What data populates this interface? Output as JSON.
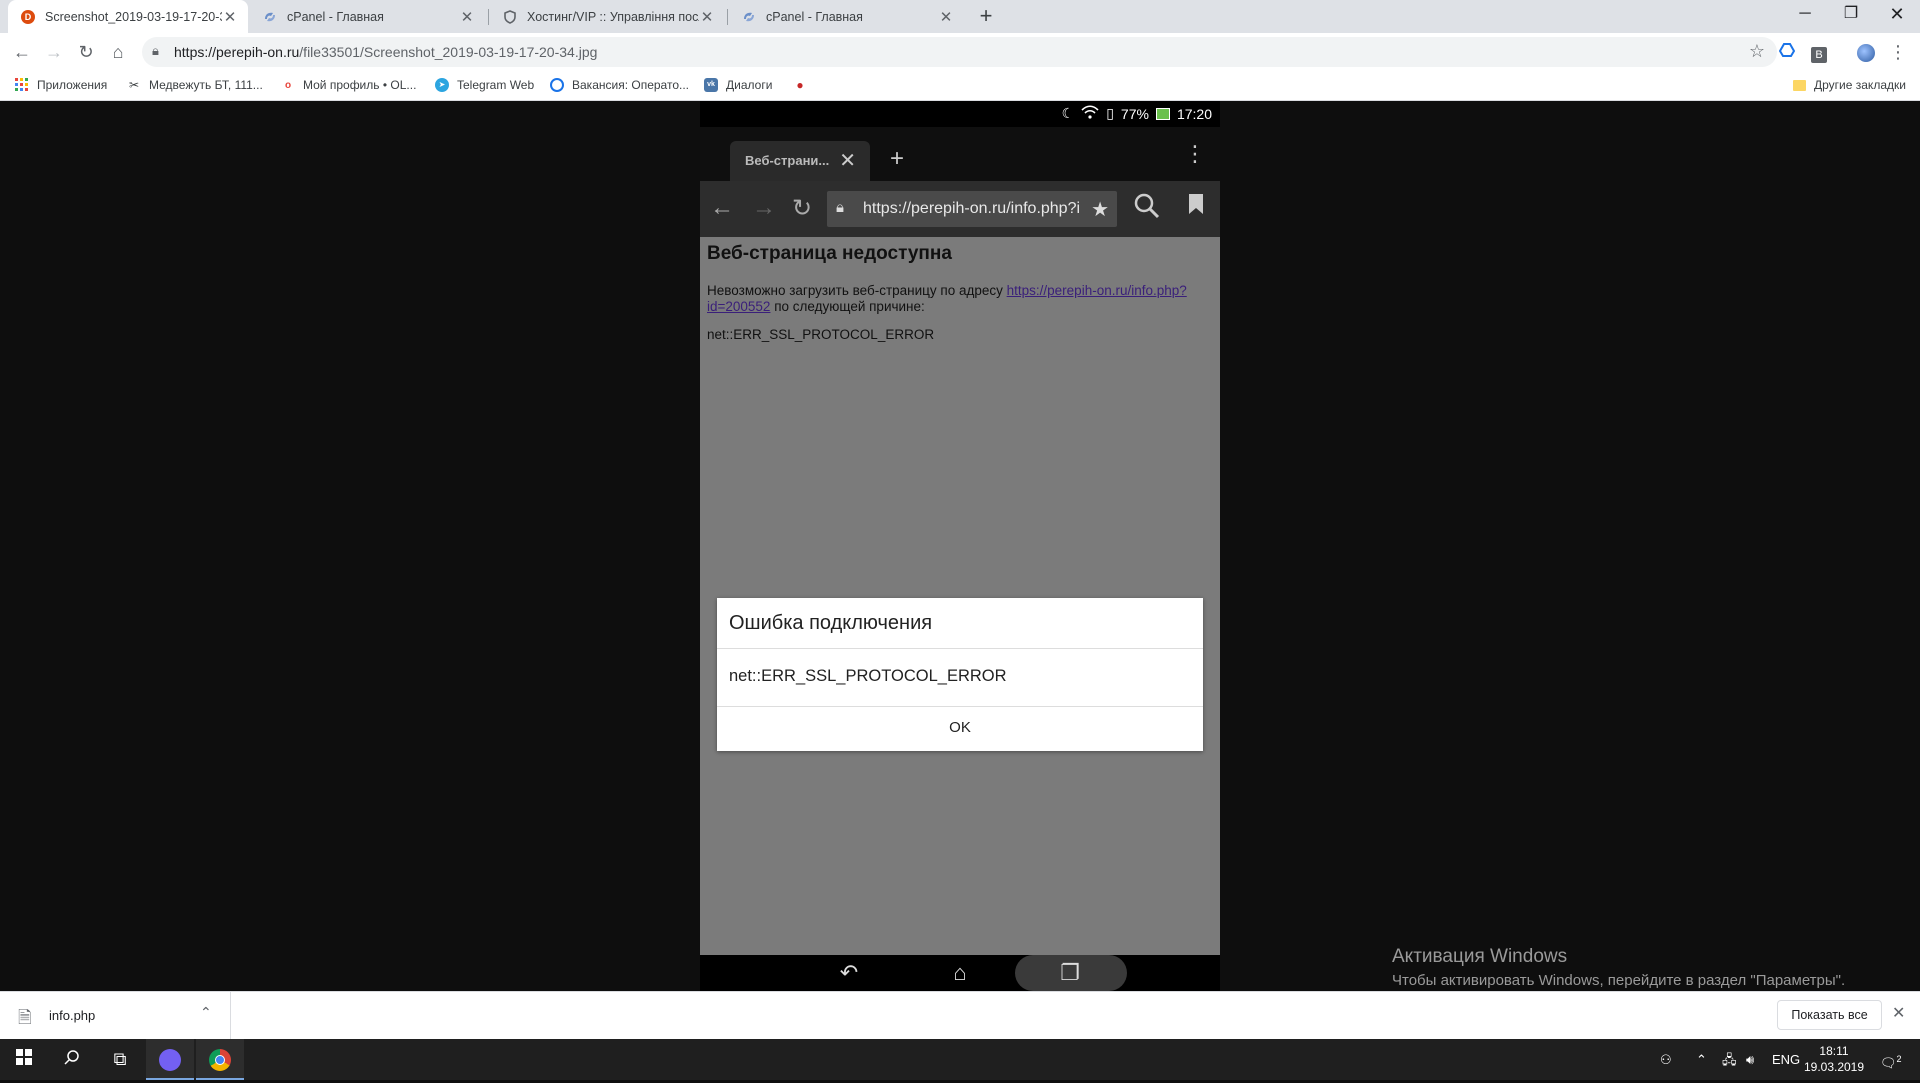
{
  "browser": {
    "tabs": [
      {
        "title": "Screenshot_2019-03-19-17-20-3",
        "favicon": "D",
        "active": true
      },
      {
        "title": "cPanel - Главная",
        "favicon": "cpanel",
        "active": false
      },
      {
        "title": "Хостинг/VIP :: Управління послу",
        "favicon": "shield",
        "active": false
      },
      {
        "title": "cPanel - Главная",
        "favicon": "cpanel",
        "active": false
      }
    ],
    "url_host": "https://perepih-on.ru",
    "url_path": "/file33501/Screenshot_2019-03-19-17-20-34.jpg",
    "profile_badge": "B",
    "bookmarks": [
      "Приложения",
      "Медвежуть БТ, 111...",
      "Мой профиль • OL...",
      "Telegram Web",
      "Вакансия: Операто...",
      "Диалоги"
    ],
    "other_bookmarks": "Другие закладки",
    "brand_color": "#dd4b0e"
  },
  "phone": {
    "status": {
      "battery": "77%",
      "time": "17:20"
    },
    "tab_title": "Веб-страни...",
    "url": "https://perepih-on.ru/info.php?i",
    "page": {
      "heading": "Веб-страница недоступна",
      "text_before_link": "Невозможно загрузить веб-страницу по адресу ",
      "link": "https://perepih-on.ru/info.php?id=200552",
      "text_after_link": " по следующей причине:",
      "error_code": "net::ERR_SSL_PROTOCOL_ERROR"
    },
    "dialog": {
      "title": "Ошибка подключения",
      "message": "net::ERR_SSL_PROTOCOL_ERROR",
      "ok": "OK"
    }
  },
  "watermark": {
    "title": "Активация Windows",
    "subtitle": "Чтобы активировать Windows, перейдите в раздел \"Параметры\"."
  },
  "downloads": {
    "file": "info.php",
    "show_all": "Показать все"
  },
  "taskbar": {
    "lang": "ENG",
    "time": "18:11",
    "date": "19.03.2019",
    "notifications": "2"
  }
}
